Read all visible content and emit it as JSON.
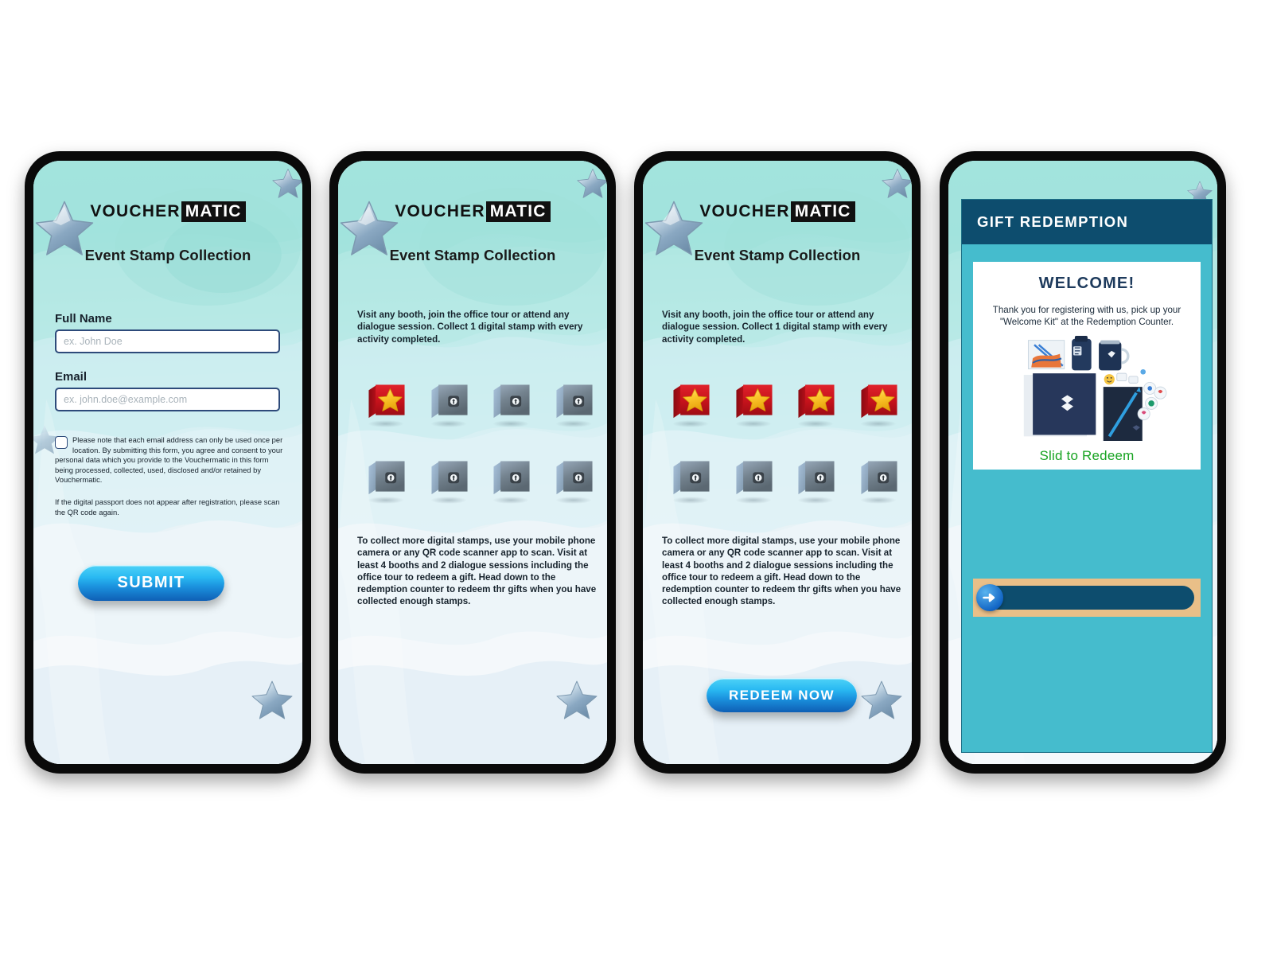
{
  "brand": {
    "word1": "VOUCHER",
    "word2": "MATIC"
  },
  "screens": [
    {
      "id": "registration",
      "page_title": "Event Stamp Collection",
      "form": {
        "full_name_label": "Full Name",
        "full_name_placeholder": "ex. John Doe",
        "full_name_value": "",
        "email_label": "Email",
        "email_placeholder": "ex. john.doe@example.com",
        "email_value": "",
        "consent_text": "Please note that each email address can only be used once per location. By submitting this form, you agree and consent to your personal data which you provide to the Vouchermatic in this form being processed, collected, used, disclosed and/or retained by Vouchermatic.",
        "note_text": "If the digital passport does not appear after registration, please scan the QR code again.",
        "submit_label": "SUBMIT"
      }
    },
    {
      "id": "passport-1-stamp",
      "page_title": "Event Stamp Collection",
      "intro_text": "Visit any booth, join the office tour or attend any dialogue session. Collect 1  digital stamp with every activity completed.",
      "outro_text": "To collect more digital stamps, use your mobile phone camera or any QR code scanner app to scan. Visit at least 4 booths and 2 dialogue sessions including the office tour to redeem a gift. Head down to the redemption counter to redeem thr gifts when you have collected enough stamps.",
      "stamps_total": 8,
      "stamps_collected": 1,
      "stamps": [
        {
          "state": "collected",
          "icon": "star-icon"
        },
        {
          "state": "locked",
          "icon": "padlock-icon"
        },
        {
          "state": "locked",
          "icon": "padlock-icon"
        },
        {
          "state": "locked",
          "icon": "padlock-icon"
        },
        {
          "state": "locked",
          "icon": "padlock-icon"
        },
        {
          "state": "locked",
          "icon": "padlock-icon"
        },
        {
          "state": "locked",
          "icon": "padlock-icon"
        },
        {
          "state": "locked",
          "icon": "padlock-icon"
        }
      ]
    },
    {
      "id": "passport-4-stamps",
      "page_title": "Event Stamp Collection",
      "intro_text": "Visit any booth, join the office tour or attend any dialogue session. Collect 1  digital stamp with every activity completed.",
      "outro_text": "To collect more digital stamps, use your mobile phone camera or any QR code scanner app to scan. Visit at least 4 booths and 2 dialogue sessions including the office tour to redeem a gift. Head down to the redemption counter to redeem thr gifts when you have collected enough stamps.",
      "stamps_total": 8,
      "stamps_collected": 4,
      "stamps": [
        {
          "state": "collected",
          "icon": "star-icon"
        },
        {
          "state": "collected",
          "icon": "star-icon"
        },
        {
          "state": "collected",
          "icon": "star-icon"
        },
        {
          "state": "collected",
          "icon": "star-icon"
        },
        {
          "state": "locked",
          "icon": "padlock-icon"
        },
        {
          "state": "locked",
          "icon": "padlock-icon"
        },
        {
          "state": "locked",
          "icon": "padlock-icon"
        },
        {
          "state": "locked",
          "icon": "padlock-icon"
        }
      ],
      "redeem_label": "REDEEM  NOW"
    },
    {
      "id": "gift-redemption",
      "header_title": "GIFT  REDEMPTION",
      "welcome_title": "WELCOME!",
      "welcome_text": "Thank you for registering with us, pick up your \"Welcome Kit\" at the Redemption Counter.",
      "slide_label": "Slid to Redeem",
      "slider_knob_icon": "arrow-right-icon",
      "kit_items": [
        "tote-bag",
        "water-bottle",
        "travel-mug",
        "folder",
        "notebook-with-pen",
        "sticker-sheet",
        "badge-buttons"
      ]
    }
  ],
  "colors": {
    "brand_dark": "#0d4d6e",
    "teal_panel": "#45bccd",
    "slider_track": "#0d4d6e",
    "slider_bed": "#e9bf88",
    "slide_label_green": "#17a321",
    "button_blue": "#29b9f2",
    "stamp_red": "#c4141d",
    "stamp_star_gold": "#f7c32b",
    "stamp_locked": "#7e8c9c",
    "input_border": "#2d4a7a"
  }
}
